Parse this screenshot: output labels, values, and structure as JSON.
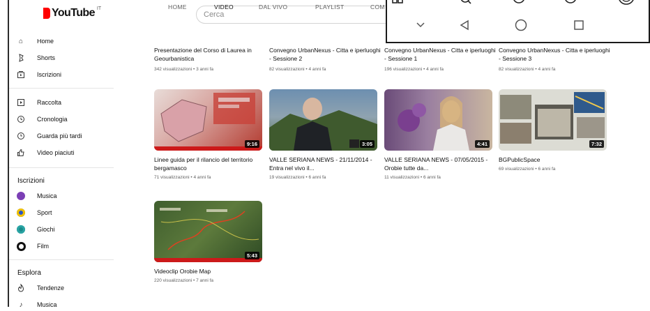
{
  "header": {
    "logo_text": "YouTube",
    "country_code": "IT",
    "search_placeholder": "Cerca"
  },
  "tabs": [
    {
      "label": "HOME"
    },
    {
      "label": "VIDEO"
    },
    {
      "label": "DAL VIVO"
    },
    {
      "label": "PLAYLIST"
    },
    {
      "label": "COM"
    }
  ],
  "sidebar": {
    "top_items": [
      {
        "label": "Home",
        "icon": "home-icon"
      },
      {
        "label": "Shorts",
        "icon": "shorts-icon"
      },
      {
        "label": "Iscrizioni",
        "icon": "subscriptions-icon"
      }
    ],
    "you_items": [
      {
        "label": "Raccolta",
        "icon": "library-icon"
      },
      {
        "label": "Cronologia",
        "icon": "history-icon"
      },
      {
        "label": "Guarda più tardi",
        "icon": "watch-later-icon"
      },
      {
        "label": "Video piaciuti",
        "icon": "like-icon"
      }
    ],
    "subs_title": "Iscrizioni",
    "subs_items": [
      {
        "label": "Musica",
        "color": "#7b3fb5"
      },
      {
        "label": "Sport",
        "color": "#2a56c6"
      },
      {
        "label": "Giochi",
        "color": "#1a8a8a"
      },
      {
        "label": "Film",
        "color": "#111111"
      }
    ],
    "explore_title": "Esplora",
    "explore_items": [
      {
        "label": "Tendenze",
        "icon": "trending-icon"
      },
      {
        "label": "Musica",
        "icon": "music-icon"
      }
    ]
  },
  "videos_row0": [
    {
      "title": "Presentazione del Corso di Laurea in Geourbanistica",
      "meta": "342 visualizzazioni • 3 anni fa"
    },
    {
      "title": "Convegno UrbanNexus - Citta e iperluoghi - Sessione 2",
      "meta": "82 visualizzazioni • 4 anni fa"
    },
    {
      "title": "Convegno UrbanNexus - Citta e iperluoghi - Sessione 1",
      "meta": "196 visualizzazioni • 4 anni fa"
    },
    {
      "title": "Convegno UrbanNexus - Citta e iperluoghi - Sessione 3",
      "meta": "82 visualizzazioni • 4 anni fa"
    }
  ],
  "videos_row1": [
    {
      "title": "Linee guida per il rilancio del territorio bergamasco",
      "meta": "71 visualizzazioni • 4 anni fa",
      "duration": "9:16"
    },
    {
      "title": "VALLE SERIANA NEWS - 21/11/2014 - Entra nel vivo il...",
      "meta": "19 visualizzazioni • 6 anni fa",
      "duration": "3:05"
    },
    {
      "title": "VALLE SERIANA NEWS - 07/05/2015 - Orobie tutte da...",
      "meta": "11 visualizzazioni • 6 anni fa",
      "duration": "4:41"
    },
    {
      "title": "BGPublicSpace",
      "meta": "69 visualizzazioni • 6 anni fa",
      "duration": "7:32"
    }
  ],
  "videos_row2": [
    {
      "title": "Videoclip Orobie Map",
      "meta": "220 visualizzazioni • 7 anni fa",
      "duration": "5:43"
    }
  ],
  "android_nav": {
    "icons": [
      "chevron-down-icon",
      "back-icon",
      "home-circle-icon",
      "recents-icon"
    ]
  }
}
